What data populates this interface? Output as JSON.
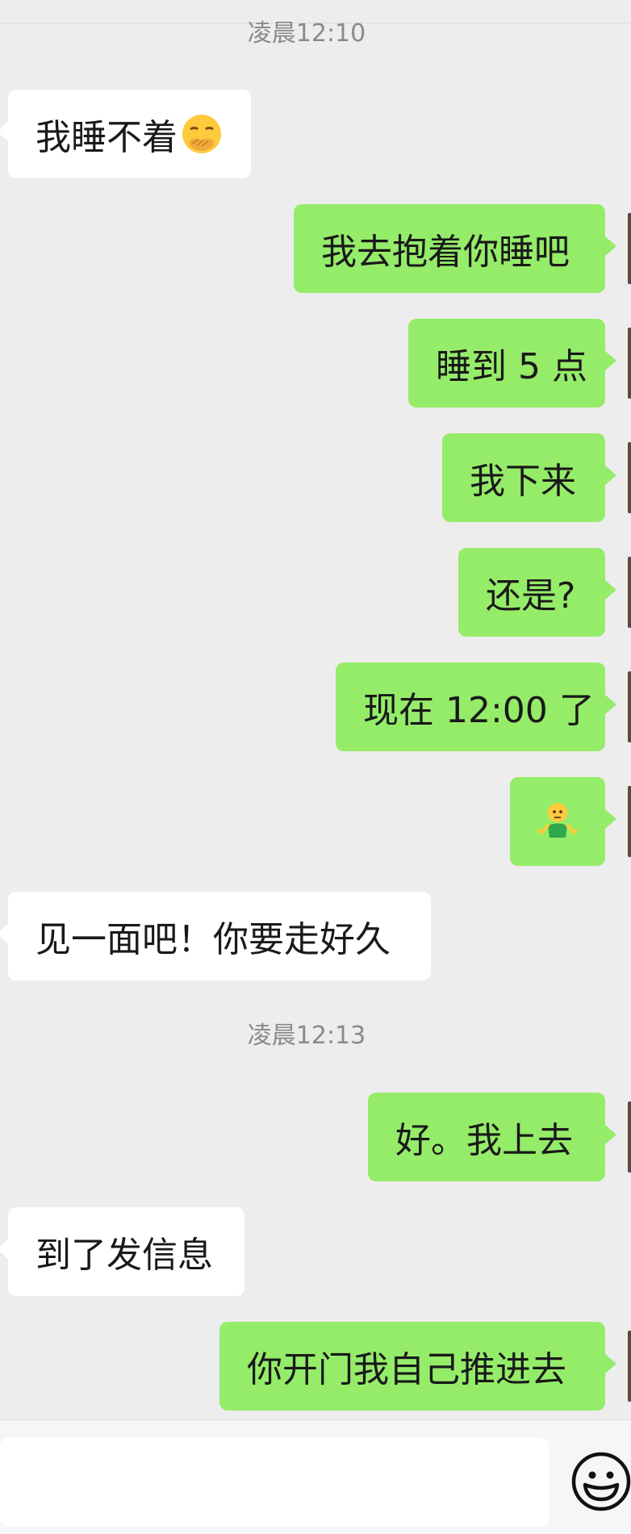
{
  "timestamps": [
    "凌晨12:10",
    "凌晨12:13"
  ],
  "messages": [
    {
      "side": "in",
      "text": "我睡不着",
      "emoji": "face-with-hand-over-mouth"
    },
    {
      "side": "out",
      "text": "我去抱着你睡吧"
    },
    {
      "side": "out",
      "text": "睡到 5 点"
    },
    {
      "side": "out",
      "text": "我下来"
    },
    {
      "side": "out",
      "text": "还是?"
    },
    {
      "side": "out",
      "text": "现在 12:00 了"
    },
    {
      "side": "out",
      "text": "",
      "emoji": "shrug-figure"
    },
    {
      "side": "in",
      "text": "见一面吧！你要走好久"
    },
    {
      "side": "out",
      "text": "好。我上去"
    },
    {
      "side": "in",
      "text": "到了发信息"
    },
    {
      "side": "out",
      "text": "你开门我自己推进去"
    }
  ],
  "input_bar": {
    "value": "",
    "emoji_button_icon": "smiley-icon"
  },
  "colors": {
    "background": "#ededed",
    "incoming_bubble": "#ffffff",
    "outgoing_bubble": "#95ec69",
    "timestamp": "#8a8a8a"
  }
}
